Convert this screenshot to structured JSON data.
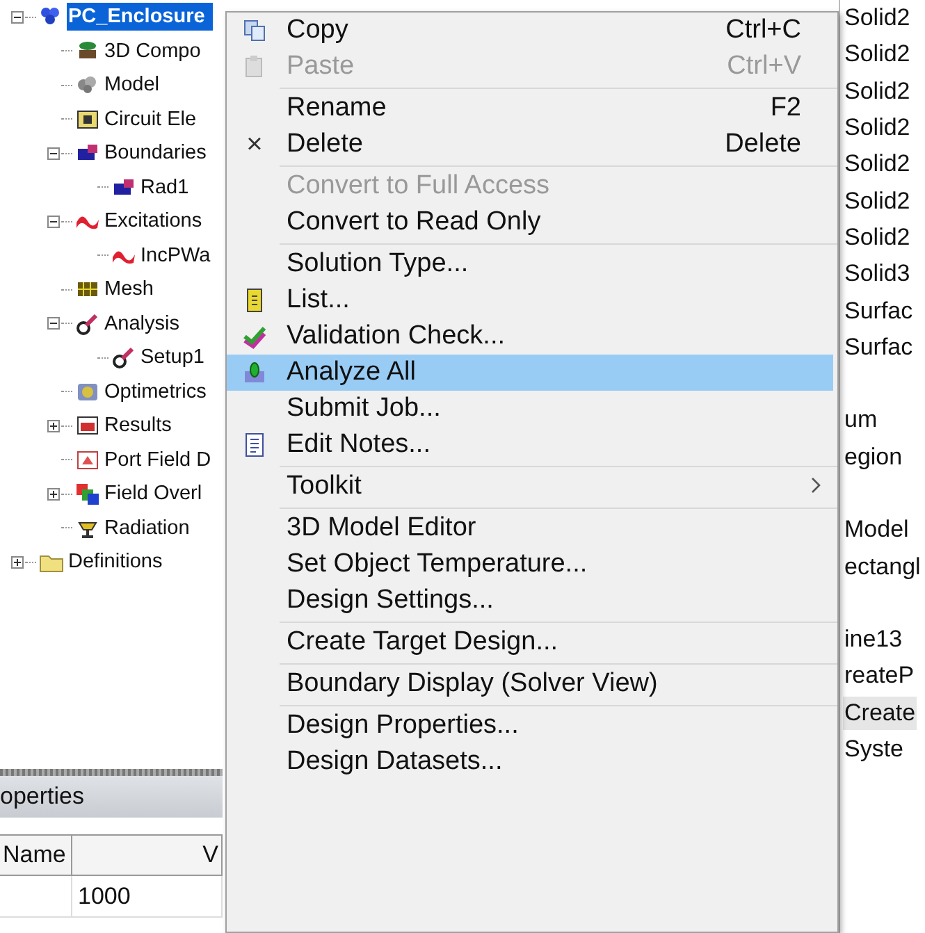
{
  "tree": [
    {
      "label": "PC_Enclosure",
      "kind": "project",
      "expanded": true,
      "selected": true,
      "children": [
        {
          "label": "3D Compo",
          "kind": "component",
          "selected": false
        },
        {
          "label": "Model",
          "kind": "model",
          "selected": false
        },
        {
          "label": "Circuit Ele",
          "kind": "circuit",
          "selected": false
        },
        {
          "label": "Boundaries",
          "kind": "boundary",
          "expanded": true,
          "selected": false,
          "children": [
            {
              "label": "Rad1",
              "kind": "boundary",
              "selected": false
            }
          ]
        },
        {
          "label": "Excitations",
          "kind": "excitation",
          "expanded": true,
          "selected": false,
          "children": [
            {
              "label": "IncPWa",
              "kind": "excitation",
              "selected": false
            }
          ]
        },
        {
          "label": "Mesh",
          "kind": "mesh",
          "selected": false
        },
        {
          "label": "Analysis",
          "kind": "analysis",
          "expanded": true,
          "selected": false,
          "children": [
            {
              "label": "Setup1",
              "kind": "analysis",
              "selected": false
            }
          ]
        },
        {
          "label": "Optimetrics",
          "kind": "optimetrics",
          "selected": false
        },
        {
          "label": "Results",
          "kind": "results",
          "expanded": false,
          "selected": false
        },
        {
          "label": "Port Field D",
          "kind": "portfield",
          "selected": false
        },
        {
          "label": "Field Overl",
          "kind": "overlay",
          "expanded": false,
          "selected": false
        },
        {
          "label": "Radiation",
          "kind": "radiation",
          "selected": false
        }
      ]
    },
    {
      "label": "Definitions",
      "kind": "folder",
      "expanded": false,
      "selected": false
    }
  ],
  "properties": {
    "title": "operties",
    "columns": [
      "Name",
      "V"
    ],
    "rows": [
      {
        "value": "1000"
      }
    ]
  },
  "side_list": [
    [
      {
        "label": "Solid2",
        "selected": false
      },
      {
        "label": "Solid2",
        "selected": false
      },
      {
        "label": "Solid2",
        "selected": false
      },
      {
        "label": "Solid2",
        "selected": false
      },
      {
        "label": "Solid2",
        "selected": false
      },
      {
        "label": "Solid2",
        "selected": false
      },
      {
        "label": "Solid2",
        "selected": false
      },
      {
        "label": "Solid3",
        "selected": false
      },
      {
        "label": "Surfac",
        "selected": false
      },
      {
        "label": "Surfac",
        "selected": false
      }
    ],
    [
      {
        "label": "um",
        "selected": false
      },
      {
        "label": "egion",
        "selected": false
      }
    ],
    [
      {
        "label": "Model",
        "selected": false
      },
      {
        "label": "ectangl",
        "selected": false
      }
    ],
    [
      {
        "label": "ine13",
        "selected": false
      },
      {
        "label": "reateP",
        "selected": false
      },
      {
        "label": "Create",
        "selected": true
      },
      {
        "label": "Syste",
        "selected": false
      }
    ]
  ],
  "context_menu": [
    {
      "kind": "item",
      "label": "Copy",
      "shortcut": "Ctrl+C",
      "disabled": false,
      "selected": false
    },
    {
      "kind": "item",
      "label": "Paste",
      "shortcut": "Ctrl+V",
      "disabled": true,
      "selected": false
    },
    {
      "kind": "separator"
    },
    {
      "kind": "item",
      "label": "Rename",
      "shortcut": "F2",
      "disabled": false,
      "selected": false
    },
    {
      "kind": "item",
      "label": "Delete",
      "shortcut": "Delete",
      "glyph": "×",
      "disabled": false,
      "selected": false
    },
    {
      "kind": "separator"
    },
    {
      "kind": "item",
      "label": "Convert to Full Access",
      "disabled": true,
      "selected": false
    },
    {
      "kind": "item",
      "label": "Convert to Read Only",
      "disabled": false,
      "selected": false
    },
    {
      "kind": "separator"
    },
    {
      "kind": "item",
      "label": "Solution Type...",
      "disabled": false,
      "selected": false
    },
    {
      "kind": "item",
      "label": "List...",
      "disabled": false,
      "selected": false
    },
    {
      "kind": "item",
      "label": "Validation Check...",
      "disabled": false,
      "selected": false
    },
    {
      "kind": "item",
      "label": "Analyze All",
      "disabled": false,
      "selected": true
    },
    {
      "kind": "item",
      "label": "Submit Job...",
      "disabled": false,
      "selected": false
    },
    {
      "kind": "item",
      "label": "Edit Notes...",
      "disabled": false,
      "selected": false
    },
    {
      "kind": "separator"
    },
    {
      "kind": "item",
      "label": "Toolkit",
      "submenu": true,
      "disabled": false,
      "selected": false
    },
    {
      "kind": "separator"
    },
    {
      "kind": "item",
      "label": "3D Model Editor",
      "disabled": false,
      "selected": false
    },
    {
      "kind": "item",
      "label": "Set Object Temperature...",
      "disabled": false,
      "selected": false
    },
    {
      "kind": "item",
      "label": "Design Settings...",
      "disabled": false,
      "selected": false
    },
    {
      "kind": "separator"
    },
    {
      "kind": "item",
      "label": "Create Target Design...",
      "disabled": false,
      "selected": false
    },
    {
      "kind": "separator"
    },
    {
      "kind": "item",
      "label": "Boundary Display (Solver View)",
      "disabled": false,
      "selected": false
    },
    {
      "kind": "separator"
    },
    {
      "kind": "item",
      "label": "Design Properties...",
      "disabled": false,
      "selected": false
    },
    {
      "kind": "item",
      "label": "Design Datasets...",
      "disabled": false,
      "selected": false
    }
  ]
}
